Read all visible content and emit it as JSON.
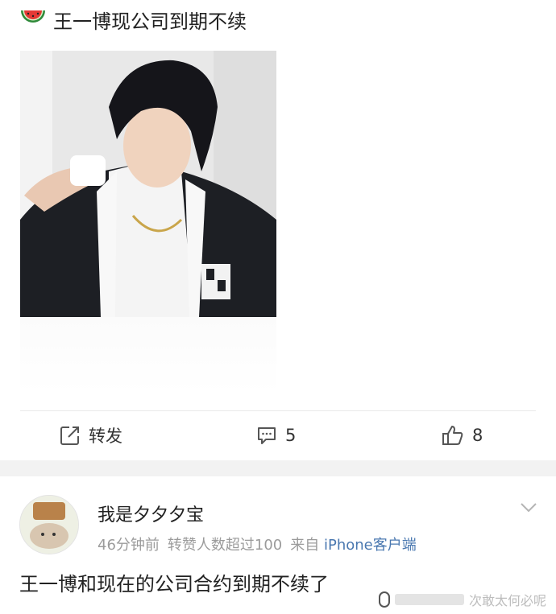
{
  "post": {
    "title": "王一博现公司到期不续",
    "title_icon": "watermelon-icon"
  },
  "actions": {
    "repost_label": "转发",
    "comment_count": "5",
    "like_count": "8"
  },
  "comment": {
    "username": "我是夕夕夕宝",
    "time": "46分钟前",
    "likes_note": "转赞人数超过100",
    "source_prefix": "来自",
    "source": "iPhone客户端",
    "text": "王一博和现在的公司合约到期不续了",
    "watermark": "次敢太何必呢"
  },
  "colors": {
    "link": "#4a78b0",
    "meta": "#9b9b9b",
    "band": "#f2f2f2"
  }
}
